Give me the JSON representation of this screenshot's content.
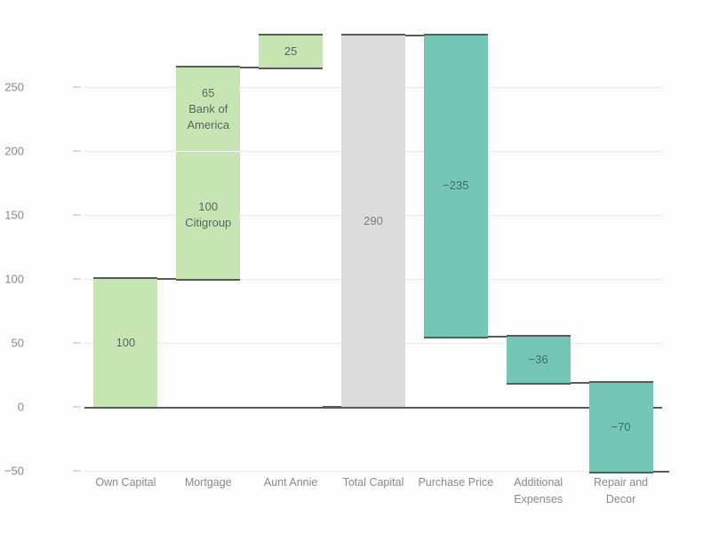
{
  "chart": {
    "type": "waterfall",
    "background_color": "#fdfdfd"
  },
  "chart_data": {
    "type": "bar",
    "title": "",
    "subtitle": "",
    "xlabel": "",
    "ylabel": "",
    "grid": true,
    "legend": "none",
    "ylim": [
      -50,
      290
    ],
    "yticks": [
      -50,
      0,
      50,
      100,
      150,
      200,
      250
    ],
    "ytick_labels": [
      "−50",
      "0",
      "50",
      "100",
      "150",
      "200",
      "250"
    ],
    "categories": [
      "Own Capital",
      "Mortgage",
      "Aunt Annie",
      "Total Capital",
      "Purchase Price",
      "Additional Expenses",
      "Repair and Decor"
    ],
    "category_labels_multiline": [
      "Own Capital",
      "Mortgage",
      "Aunt Annie",
      "Total Capital",
      "Purchase Price",
      "Additional\nExpenses",
      "Repair and\nDecor"
    ],
    "values": [
      100,
      165,
      25,
      290,
      -235,
      -36,
      -70
    ],
    "bars": [
      {
        "category": "Own Capital",
        "kind": "increase",
        "value": 100,
        "start": 0,
        "end": 100,
        "color": "#c6e5b3",
        "segments": [
          {
            "label": "100",
            "value": 100,
            "start": 0,
            "end": 100
          }
        ]
      },
      {
        "category": "Mortgage",
        "kind": "increase",
        "value": 165,
        "start": 100,
        "end": 265,
        "color": "#c6e5b3",
        "segments": [
          {
            "label": "100\nCitigroup",
            "value": 100,
            "start": 100,
            "end": 200
          },
          {
            "label": "65\nBank of\nAmerica",
            "value": 65,
            "start": 200,
            "end": 265
          }
        ]
      },
      {
        "category": "Aunt Annie",
        "kind": "increase",
        "value": 25,
        "start": 265,
        "end": 290,
        "color": "#c6e5b3",
        "segments": [
          {
            "label": "25",
            "value": 25,
            "start": 265,
            "end": 290
          }
        ]
      },
      {
        "category": "Total Capital",
        "kind": "total",
        "value": 290,
        "start": 0,
        "end": 290,
        "color": "#dcdcdc",
        "segments": [
          {
            "label": "290",
            "value": 290,
            "start": 0,
            "end": 290
          }
        ]
      },
      {
        "category": "Purchase Price",
        "kind": "decrease",
        "value": -235,
        "start": 290,
        "end": 55,
        "color": "#74c7b6",
        "segments": [
          {
            "label": "−235",
            "value": -235,
            "start": 290,
            "end": 55
          }
        ]
      },
      {
        "category": "Additional Expenses",
        "kind": "decrease",
        "value": -36,
        "start": 55,
        "end": 19,
        "color": "#74c7b6",
        "segments": [
          {
            "label": "−36",
            "value": -36,
            "start": 55,
            "end": 19
          }
        ]
      },
      {
        "category": "Repair and Decor",
        "kind": "decrease",
        "value": -70,
        "start": 19,
        "end": -51,
        "color": "#74c7b6",
        "segments": [
          {
            "label": "−70",
            "value": -70,
            "start": 19,
            "end": -51
          }
        ]
      }
    ],
    "colors": {
      "increase": "#c6e5b3",
      "decrease": "#74c7b6",
      "total": "#dcdcdc",
      "connector": "#555c5a",
      "gridline": "#d8d8d8",
      "axis_text": "#8a8a8a",
      "label_text": "#5a6660"
    }
  }
}
